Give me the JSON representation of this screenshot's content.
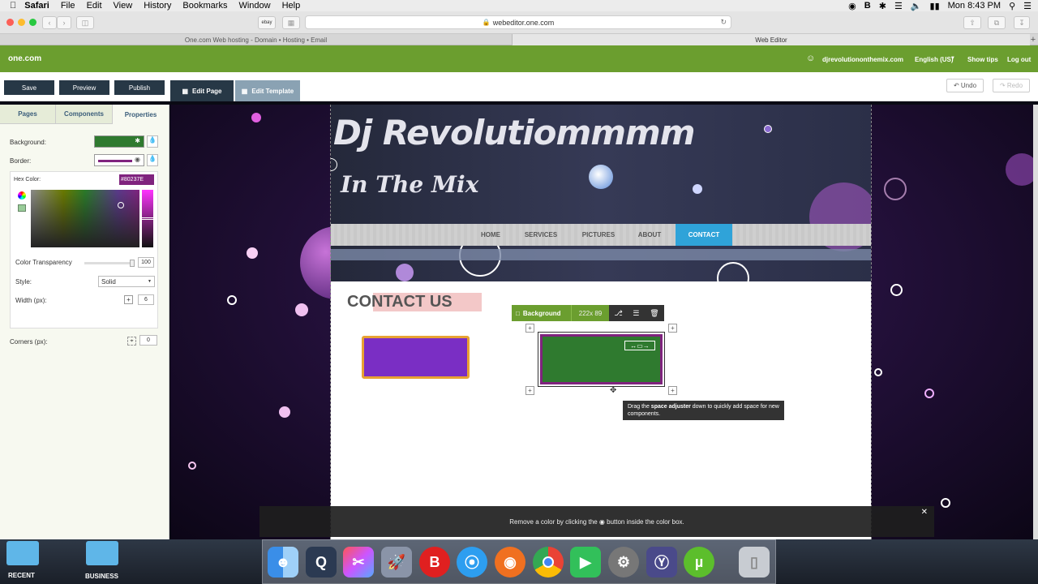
{
  "menubar": {
    "app": "Safari",
    "items": [
      "File",
      "Edit",
      "View",
      "History",
      "Bookmarks",
      "Window",
      "Help"
    ],
    "time": "Mon 8:43 PM"
  },
  "browser": {
    "url": "webeditor.one.com",
    "bookmark_label": "ebay",
    "tabs": [
      "One.com Web hosting  -  Domain • Hosting • Email",
      "Web Editor"
    ]
  },
  "header": {
    "logo": "one.com",
    "user": "djrevolutiononthemix.com",
    "language": "English (US)",
    "show_tips": "Show tips",
    "logout": "Log out"
  },
  "actions": {
    "save": "Save",
    "preview": "Preview",
    "publish": "Publish",
    "edit_page": "Edit Page",
    "edit_template": "Edit Template",
    "undo": "Undo",
    "redo": "Redo"
  },
  "panel": {
    "tabs": [
      "Pages",
      "Components",
      "Properties"
    ],
    "background_label": "Background:",
    "border_label": "Border:",
    "hex_label": "Hex Color:",
    "hex_value": "#80237E",
    "transparency_label": "Color Transparency",
    "transparency_value": "100",
    "style_label": "Style:",
    "style_value": "Solid",
    "width_label": "Width (px):",
    "width_value": "6",
    "corners_label": "Corners (px):",
    "corners_value": "0"
  },
  "site": {
    "title_line1": "Dj Revolutiommmm",
    "title_line2": "In The Mix",
    "nav": [
      "HOME",
      "SERVICES",
      "PICTURES",
      "ABOUT",
      "CONTACT"
    ],
    "contact_heading": "CONTACT US"
  },
  "component_toolbar": {
    "label": "Background",
    "size": "222x 89"
  },
  "tooltip": {
    "prefix": "Drag the ",
    "strong": "space adjuster",
    "suffix": " down to quickly add space for new components."
  },
  "notice": "Remove a color by clicking the ◉ button inside the color box.",
  "dock": {
    "folders": [
      "RECENT",
      "BUSINESS"
    ]
  },
  "colors": {
    "green_header": "#6b9e2f",
    "background_swatch": "#2f7a2f",
    "border_color": "#80237e",
    "contact_active": "#2fa3d9",
    "purple_box": "#7a2ec4",
    "orange_border": "#e8a232"
  }
}
